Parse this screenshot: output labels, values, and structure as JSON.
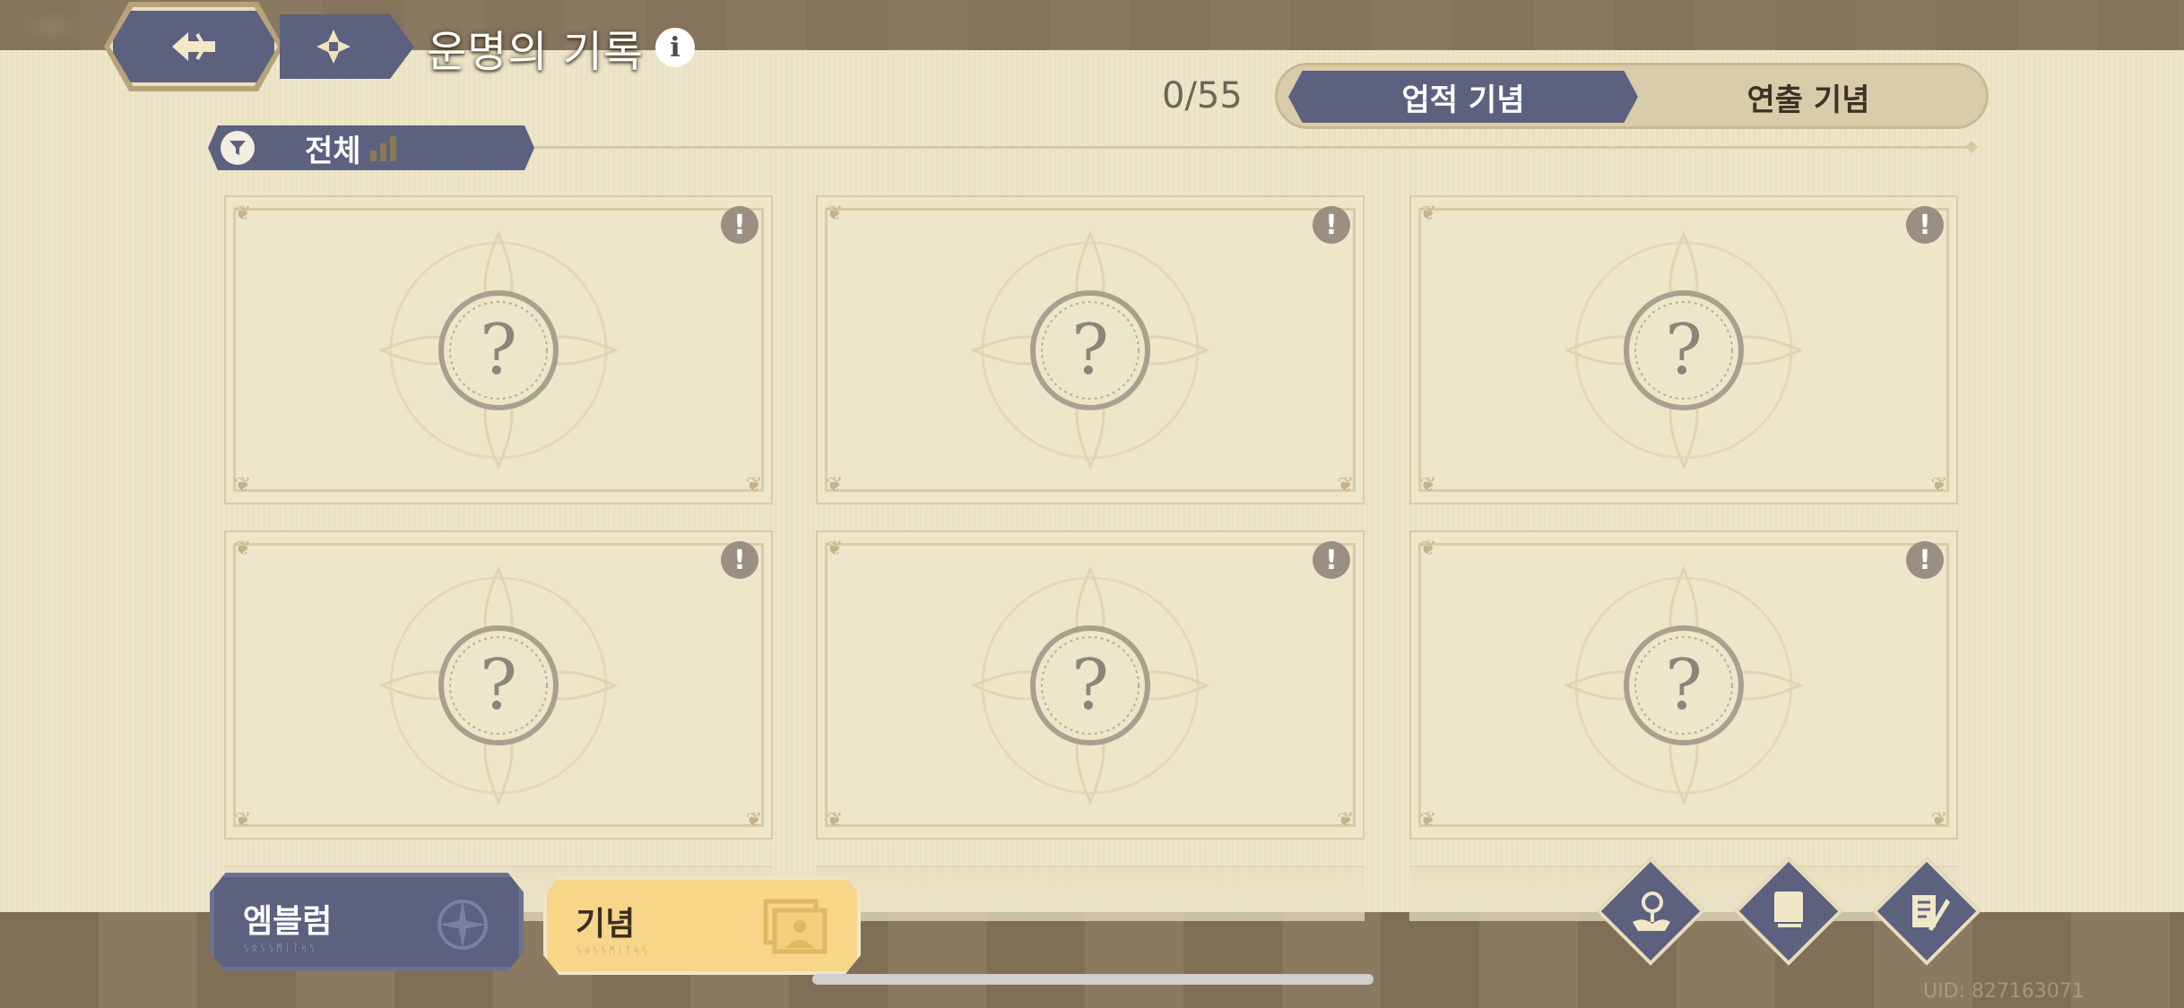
{
  "header": {
    "title": "운명의 기록",
    "back_icon": "back-arrow-icon",
    "menu_icon": "grid-menu-icon",
    "info_icon": "i"
  },
  "progress": {
    "counter": "0/55"
  },
  "tabs": [
    {
      "label": "업적 기념",
      "active": true
    },
    {
      "label": "연출 기념",
      "active": false
    }
  ],
  "filter": {
    "label": "전체",
    "icon": "filter-icon"
  },
  "cards": [
    {
      "status": "locked",
      "symbol": "?",
      "badge": "!"
    },
    {
      "status": "locked",
      "symbol": "?",
      "badge": "!"
    },
    {
      "status": "locked",
      "symbol": "?",
      "badge": "!"
    },
    {
      "status": "locked",
      "symbol": "?",
      "badge": "!"
    },
    {
      "status": "locked",
      "symbol": "?",
      "badge": "!"
    },
    {
      "status": "locked",
      "symbol": "?",
      "badge": "!"
    }
  ],
  "bottom_tabs": [
    {
      "label": "엠블럼",
      "active": false
    },
    {
      "label": "기념",
      "active": true
    }
  ],
  "action_buttons": [
    {
      "icon": "flower-hand-icon"
    },
    {
      "icon": "book-icon"
    },
    {
      "icon": "scroll-quill-icon"
    }
  ],
  "colors": {
    "accent": "#5d6180",
    "parchment": "#ede5c8",
    "active_tab": "#f7d68a",
    "border": "#85745b"
  },
  "footer": {
    "uid": "UID: 827163071"
  }
}
